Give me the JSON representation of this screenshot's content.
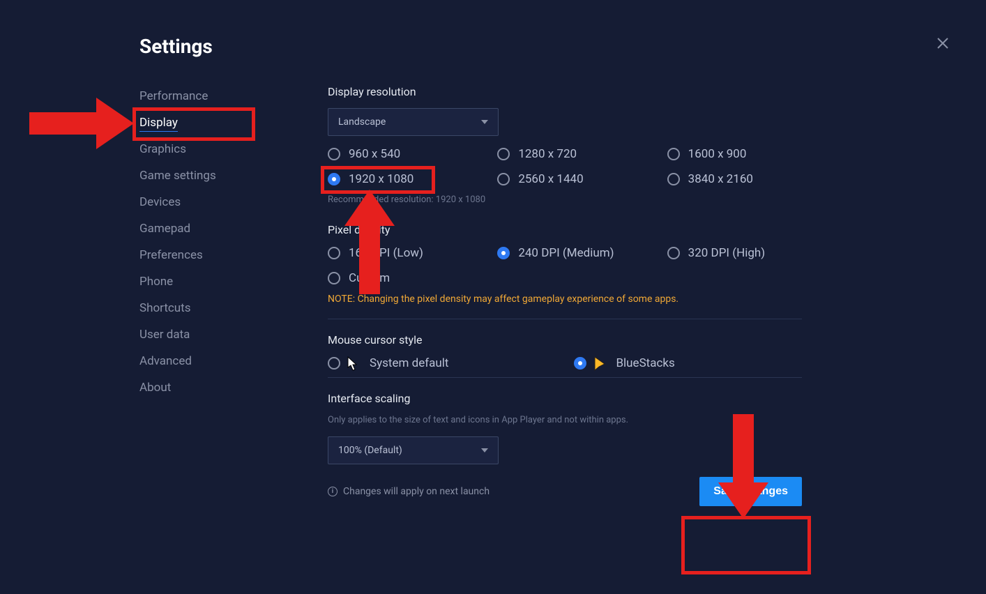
{
  "title": "Settings",
  "sidebar": {
    "items": [
      {
        "label": "Performance",
        "active": false
      },
      {
        "label": "Display",
        "active": true
      },
      {
        "label": "Graphics",
        "active": false
      },
      {
        "label": "Game settings",
        "active": false
      },
      {
        "label": "Devices",
        "active": false
      },
      {
        "label": "Gamepad",
        "active": false
      },
      {
        "label": "Preferences",
        "active": false
      },
      {
        "label": "Phone",
        "active": false
      },
      {
        "label": "Shortcuts",
        "active": false
      },
      {
        "label": "User data",
        "active": false
      },
      {
        "label": "Advanced",
        "active": false
      },
      {
        "label": "About",
        "active": false
      }
    ]
  },
  "resolution": {
    "label": "Display resolution",
    "orientation": "Landscape",
    "options": [
      {
        "label": "960 x 540",
        "selected": false
      },
      {
        "label": "1280 x 720",
        "selected": false
      },
      {
        "label": "1600 x 900",
        "selected": false
      },
      {
        "label": "1920 x 1080",
        "selected": true
      },
      {
        "label": "2560 x 1440",
        "selected": false
      },
      {
        "label": "3840 x 2160",
        "selected": false
      }
    ],
    "recommended": "Recommended resolution: 1920 x 1080"
  },
  "density": {
    "label": "Pixel density",
    "options": [
      {
        "label": "160 DPI (Low)",
        "selected": false
      },
      {
        "label": "240 DPI (Medium)",
        "selected": true
      },
      {
        "label": "320 DPI (High)",
        "selected": false
      },
      {
        "label": "Custom",
        "selected": false
      }
    ],
    "note": "NOTE: Changing the pixel density may affect gameplay experience of some apps."
  },
  "cursor": {
    "label": "Mouse cursor style",
    "options": [
      {
        "label": "System default",
        "selected": false
      },
      {
        "label": "BlueStacks",
        "selected": true
      }
    ]
  },
  "scaling": {
    "label": "Interface scaling",
    "hint": "Only applies to the size of text and icons in App Player and not within apps.",
    "value": "100% (Default)"
  },
  "footer": {
    "info": "Changes will apply on next launch",
    "save": "Save changes"
  }
}
